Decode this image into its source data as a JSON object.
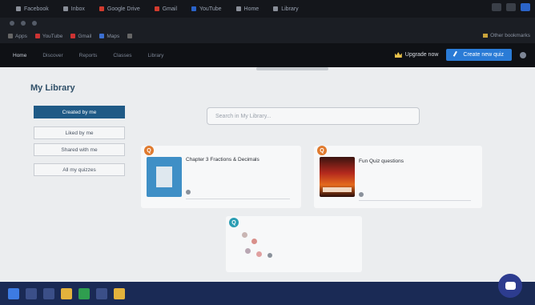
{
  "browser": {
    "tabs": [
      {
        "label": "Facebook",
        "color": "grey"
      },
      {
        "label": "Inbox",
        "color": "grey"
      },
      {
        "label": "Google Drive",
        "color": "red"
      },
      {
        "label": "Gmail",
        "color": "red"
      },
      {
        "label": "YouTube",
        "color": "blue"
      },
      {
        "label": "Home",
        "color": "grey"
      },
      {
        "label": "Library",
        "color": "grey"
      }
    ],
    "url": "",
    "bookmarks": [
      {
        "label": "Apps",
        "icon": "grid-icon"
      },
      {
        "label": "YouTube",
        "icon": "youtube-icon"
      },
      {
        "label": "Gmail",
        "icon": "mail-icon"
      },
      {
        "label": "Maps",
        "icon": "map-icon"
      },
      {
        "label": "",
        "icon": "bookmark-icon"
      }
    ],
    "bookmarks_right": "Other bookmarks"
  },
  "appnav": {
    "items": [
      "Home",
      "Discover",
      "Reports",
      "Classes",
      "Library"
    ],
    "upgrade_label": "Upgrade now",
    "create_label": "Create new quiz",
    "user_label": ""
  },
  "library": {
    "title": "My Library",
    "side_buttons": [
      "Created by me",
      "Liked by me",
      "Shared with me",
      "All my quizzes"
    ],
    "search_placeholder": "Search in My Library..."
  },
  "cards": [
    {
      "badge": "Q",
      "title": "Chapter 3 Fractions & Decimals",
      "subtitle": "",
      "footer": "",
      "thumb": "document"
    },
    {
      "badge": "Q",
      "title": "Fun Quiz questions",
      "subtitle": "",
      "footer": "",
      "thumb": "image"
    },
    {
      "badge": "Q",
      "title": "",
      "subtitle": "",
      "footer": "",
      "thumb": "cluster"
    }
  ],
  "colors": {
    "accent": "#2a7bd6",
    "sidebar_active": "#1f5a86",
    "badge_orange": "#e07a2e",
    "badge_teal": "#2a9db3",
    "taskbar": "#1a2a55"
  }
}
